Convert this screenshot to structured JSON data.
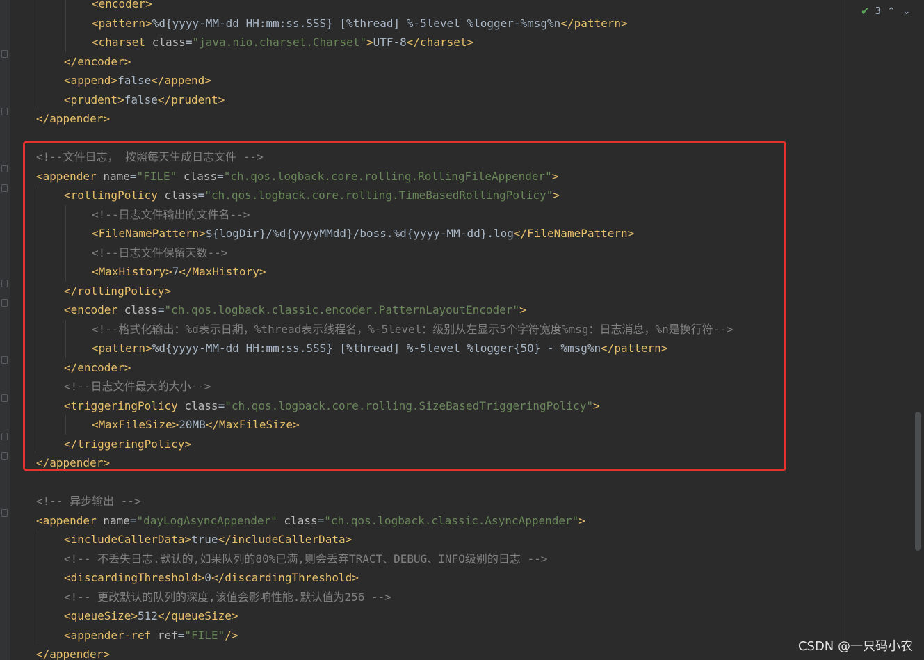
{
  "inspections": {
    "count": "3"
  },
  "watermark": "CSDN @一只码小农",
  "lines": [
    {
      "indent": 2,
      "tokens": [
        {
          "k": "t",
          "s": "<encoder>"
        }
      ]
    },
    {
      "indent": 2,
      "tokens": [
        {
          "k": "t",
          "s": "<pattern>"
        },
        {
          "k": "x",
          "s": "%d{yyyy-MM-dd HH:mm:ss.SSS} [%thread] %-5level %logger-%msg%n"
        },
        {
          "k": "t",
          "s": "</pattern>"
        }
      ]
    },
    {
      "indent": 2,
      "tokens": [
        {
          "k": "t",
          "s": "<charset "
        },
        {
          "k": "a",
          "s": "class"
        },
        {
          "k": "eq",
          "s": "="
        },
        {
          "k": "v",
          "s": "\"java.nio.charset.Charset\""
        },
        {
          "k": "t",
          "s": ">"
        },
        {
          "k": "x",
          "s": "UTF-8"
        },
        {
          "k": "t",
          "s": "</charset>"
        }
      ]
    },
    {
      "indent": 1,
      "tokens": [
        {
          "k": "t",
          "s": "</encoder>"
        }
      ]
    },
    {
      "indent": 1,
      "tokens": [
        {
          "k": "t",
          "s": "<append>"
        },
        {
          "k": "x",
          "s": "false"
        },
        {
          "k": "t",
          "s": "</append>"
        }
      ]
    },
    {
      "indent": 1,
      "tokens": [
        {
          "k": "t",
          "s": "<prudent>"
        },
        {
          "k": "x",
          "s": "false"
        },
        {
          "k": "t",
          "s": "</prudent>"
        }
      ]
    },
    {
      "indent": 0,
      "tokens": [
        {
          "k": "t",
          "s": "</appender>"
        }
      ]
    },
    {
      "indent": 0,
      "tokens": []
    },
    {
      "indent": 0,
      "tokens": [
        {
          "k": "c",
          "s": "<!--文件日志， 按照每天生成日志文件 -->"
        }
      ]
    },
    {
      "indent": 0,
      "tokens": [
        {
          "k": "t",
          "s": "<appender "
        },
        {
          "k": "a",
          "s": "name"
        },
        {
          "k": "eq",
          "s": "="
        },
        {
          "k": "v",
          "s": "\"FILE\""
        },
        {
          "k": "a",
          "s": " class"
        },
        {
          "k": "eq",
          "s": "="
        },
        {
          "k": "v",
          "s": "\"ch.qos.logback.core.rolling.RollingFileAppender\""
        },
        {
          "k": "t",
          "s": ">"
        }
      ]
    },
    {
      "indent": 1,
      "tokens": [
        {
          "k": "t",
          "s": "<rollingPolicy "
        },
        {
          "k": "a",
          "s": "class"
        },
        {
          "k": "eq",
          "s": "="
        },
        {
          "k": "v",
          "s": "\"ch.qos.logback.core.rolling.TimeBasedRollingPolicy\""
        },
        {
          "k": "t",
          "s": ">"
        }
      ]
    },
    {
      "indent": 2,
      "tokens": [
        {
          "k": "c",
          "s": "<!--日志文件输出的文件名-->"
        }
      ]
    },
    {
      "indent": 2,
      "tokens": [
        {
          "k": "t",
          "s": "<FileNamePattern>"
        },
        {
          "k": "x",
          "s": "${logDir}/%d{yyyyMMdd}/boss.%d{yyyy-MM-dd}.log"
        },
        {
          "k": "t",
          "s": "</FileNamePattern>"
        }
      ]
    },
    {
      "indent": 2,
      "tokens": [
        {
          "k": "c",
          "s": "<!--日志文件保留天数-->"
        }
      ]
    },
    {
      "indent": 2,
      "tokens": [
        {
          "k": "t",
          "s": "<MaxHistory>"
        },
        {
          "k": "x",
          "s": "7"
        },
        {
          "k": "t",
          "s": "</MaxHistory>"
        }
      ]
    },
    {
      "indent": 1,
      "tokens": [
        {
          "k": "t",
          "s": "</rollingPolicy>"
        }
      ]
    },
    {
      "indent": 1,
      "tokens": [
        {
          "k": "t",
          "s": "<encoder "
        },
        {
          "k": "a",
          "s": "class"
        },
        {
          "k": "eq",
          "s": "="
        },
        {
          "k": "v",
          "s": "\"ch.qos.logback.classic.encoder.PatternLayoutEncoder\""
        },
        {
          "k": "t",
          "s": ">"
        }
      ]
    },
    {
      "indent": 2,
      "tokens": [
        {
          "k": "c",
          "s": "<!--格式化输出：%d表示日期，%thread表示线程名，%-5level：级别从左显示5个字符宽度%msg：日志消息，%n是换行符-->"
        }
      ]
    },
    {
      "indent": 2,
      "tokens": [
        {
          "k": "t",
          "s": "<pattern>"
        },
        {
          "k": "x",
          "s": "%d{yyyy-MM-dd HH:mm:ss.SSS} [%thread] %-5level %logger{50} - %msg%n"
        },
        {
          "k": "t",
          "s": "</pattern>"
        }
      ]
    },
    {
      "indent": 1,
      "tokens": [
        {
          "k": "t",
          "s": "</encoder>"
        }
      ]
    },
    {
      "indent": 1,
      "tokens": [
        {
          "k": "c",
          "s": "<!--日志文件最大的大小-->"
        }
      ]
    },
    {
      "indent": 1,
      "tokens": [
        {
          "k": "t",
          "s": "<triggeringPolicy "
        },
        {
          "k": "a",
          "s": "class"
        },
        {
          "k": "eq",
          "s": "="
        },
        {
          "k": "v",
          "s": "\"ch.qos.logback.core.rolling.SizeBasedTriggeringPolicy\""
        },
        {
          "k": "t",
          "s": ">"
        }
      ]
    },
    {
      "indent": 2,
      "tokens": [
        {
          "k": "t",
          "s": "<MaxFileSize>"
        },
        {
          "k": "x",
          "s": "20MB"
        },
        {
          "k": "t",
          "s": "</MaxFileSize>"
        }
      ]
    },
    {
      "indent": 1,
      "tokens": [
        {
          "k": "t",
          "s": "</triggeringPolicy>"
        }
      ]
    },
    {
      "indent": 0,
      "tokens": [
        {
          "k": "t",
          "s": "</appender>"
        }
      ]
    },
    {
      "indent": 0,
      "tokens": []
    },
    {
      "indent": 0,
      "tokens": [
        {
          "k": "c",
          "s": "<!-- 异步输出 -->"
        }
      ]
    },
    {
      "indent": 0,
      "tokens": [
        {
          "k": "t",
          "s": "<appender "
        },
        {
          "k": "a",
          "s": "name"
        },
        {
          "k": "eq",
          "s": "="
        },
        {
          "k": "v",
          "s": "\"dayLogAsyncAppender\""
        },
        {
          "k": "a",
          "s": " class"
        },
        {
          "k": "eq",
          "s": "="
        },
        {
          "k": "v",
          "s": "\"ch.qos.logback.classic.AsyncAppender\""
        },
        {
          "k": "t",
          "s": ">"
        }
      ]
    },
    {
      "indent": 1,
      "tokens": [
        {
          "k": "t",
          "s": "<includeCallerData>"
        },
        {
          "k": "x",
          "s": "true"
        },
        {
          "k": "t",
          "s": "</includeCallerData>"
        }
      ]
    },
    {
      "indent": 1,
      "tokens": [
        {
          "k": "c",
          "s": "<!-- 不丢失日志.默认的,如果队列的80%已满,则会丢弃TRACT、DEBUG、INFO级别的日志 -->"
        }
      ]
    },
    {
      "indent": 1,
      "tokens": [
        {
          "k": "t",
          "s": "<discardingThreshold>"
        },
        {
          "k": "x",
          "s": "0"
        },
        {
          "k": "t",
          "s": "</discardingThreshold>"
        }
      ]
    },
    {
      "indent": 1,
      "tokens": [
        {
          "k": "c",
          "s": "<!-- 更改默认的队列的深度,该值会影响性能.默认值为256 -->"
        }
      ]
    },
    {
      "indent": 1,
      "tokens": [
        {
          "k": "t",
          "s": "<queueSize>"
        },
        {
          "k": "x",
          "s": "512"
        },
        {
          "k": "t",
          "s": "</queueSize>"
        }
      ]
    },
    {
      "indent": 1,
      "tokens": [
        {
          "k": "t",
          "s": "<appender-ref "
        },
        {
          "k": "a",
          "s": "ref"
        },
        {
          "k": "eq",
          "s": "="
        },
        {
          "k": "v",
          "s": "\"FILE\""
        },
        {
          "k": "t",
          "s": "/>"
        }
      ]
    },
    {
      "indent": 0,
      "tokens": [
        {
          "k": "t",
          "s": "</appender>"
        }
      ]
    }
  ]
}
